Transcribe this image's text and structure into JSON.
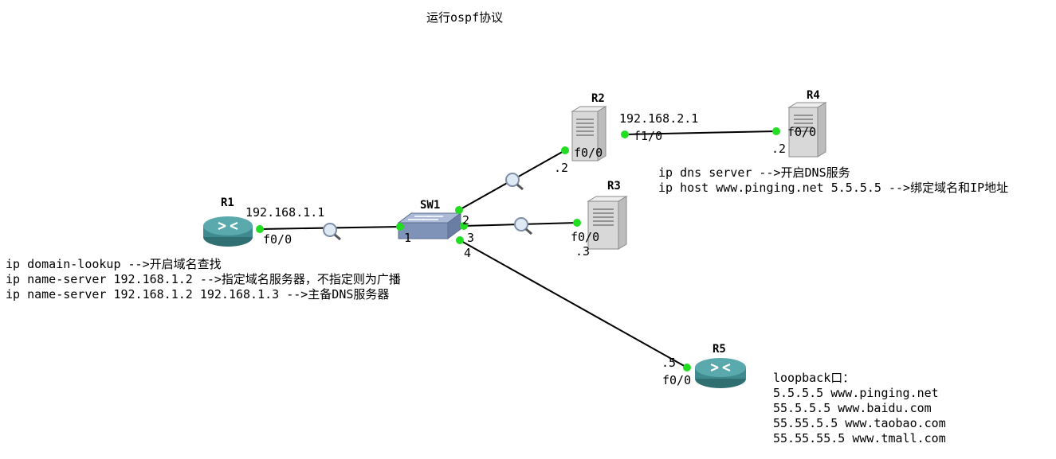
{
  "title": "运行ospf协议",
  "devices": {
    "r1": {
      "name": "R1"
    },
    "r2": {
      "name": "R2"
    },
    "r3": {
      "name": "R3"
    },
    "r4": {
      "name": "R4"
    },
    "r5": {
      "name": "R5"
    },
    "sw1": {
      "name": "SW1"
    }
  },
  "labels": {
    "r1_ip": "192.168.1.1",
    "r1_if": "f0/0",
    "sw_p1": "1",
    "sw_p2": "2",
    "sw_p3": "3",
    "sw_p4": "4",
    "r2_if0": "f0/0",
    "r2_host": ".2",
    "r2_ip": "192.168.2.1",
    "r2_if1": "f1/0",
    "r4_if": "f0/0",
    "r4_host": ".2",
    "r3_if": "f0/0",
    "r3_host": ".3",
    "r5_host": ".5",
    "r5_if": "f0/0"
  },
  "notes": {
    "r1": [
      "ip domain-lookup -->开启域名查找",
      "ip name-server 192.168.1.2 -->指定域名服务器，不指定则为广播",
      "ip name-server 192.168.1.2 192.168.1.3 -->主备DNS服务器"
    ],
    "r4": [
      "ip dns server -->开启DNS服务",
      "ip host www.pinging.net 5.5.5.5 -->绑定域名和IP地址"
    ],
    "r5": [
      "loopback口：",
      "5.5.5.5 www.pinging.net",
      "55.5.5.5 www.baidu.com",
      "55.55.5.5 www.taobao.com",
      "55.55.55.5 www.tmall.com"
    ]
  },
  "colors": {
    "link": "#000000",
    "port_dot": "#22dd22",
    "router_body": "#3f8a8e",
    "router_top": "#5aa9ad",
    "switch_body": "#7f93b8",
    "server_body": "#d8d8d8"
  },
  "icons": {
    "router": "router-icon",
    "switch": "switch-icon",
    "server": "server-icon",
    "capture": "magnifier-icon"
  }
}
